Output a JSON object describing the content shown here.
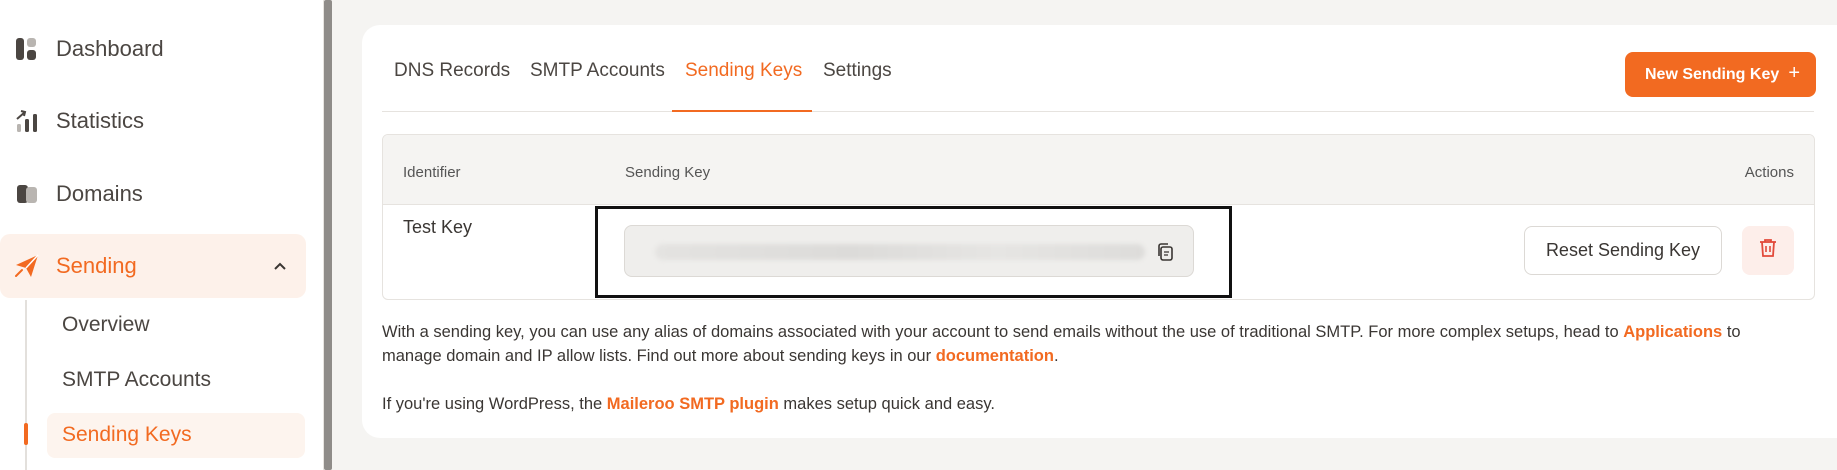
{
  "sidebar": {
    "items": [
      {
        "label": "Dashboard",
        "icon": "dashboard-icon"
      },
      {
        "label": "Statistics",
        "icon": "statistics-icon"
      },
      {
        "label": "Domains",
        "icon": "domains-icon"
      },
      {
        "label": "Sending",
        "icon": "paper-plane-icon"
      }
    ],
    "sub_items": [
      {
        "label": "Overview"
      },
      {
        "label": "SMTP Accounts"
      },
      {
        "label": "Sending Keys"
      }
    ]
  },
  "tabs": [
    {
      "label": "DNS Records"
    },
    {
      "label": "SMTP Accounts"
    },
    {
      "label": "Sending Keys"
    },
    {
      "label": "Settings"
    }
  ],
  "new_button": {
    "label": "New Sending Key",
    "plus": "+"
  },
  "table": {
    "headers": {
      "identifier": "Identifier",
      "sending_key": "Sending Key",
      "actions": "Actions"
    },
    "rows": [
      {
        "identifier": "Test Key",
        "reset_label": "Reset Sending Key"
      }
    ]
  },
  "info": {
    "p1_a": "With a sending key, you can use any alias of domains associated with your account to send emails without the use of traditional SMTP. For more complex setups, head to ",
    "p1_link1": "Applications",
    "p1_b": " to manage domain and IP allow lists. Find out more about sending keys in our ",
    "p1_link2": "documentation",
    "p1_c": ".",
    "p2_a": "If you're using WordPress, the ",
    "p2_link": "Maileroo SMTP plugin",
    "p2_b": " makes setup quick and easy."
  },
  "colors": {
    "accent": "#f26a21",
    "danger_bg": "#fdeeea"
  }
}
